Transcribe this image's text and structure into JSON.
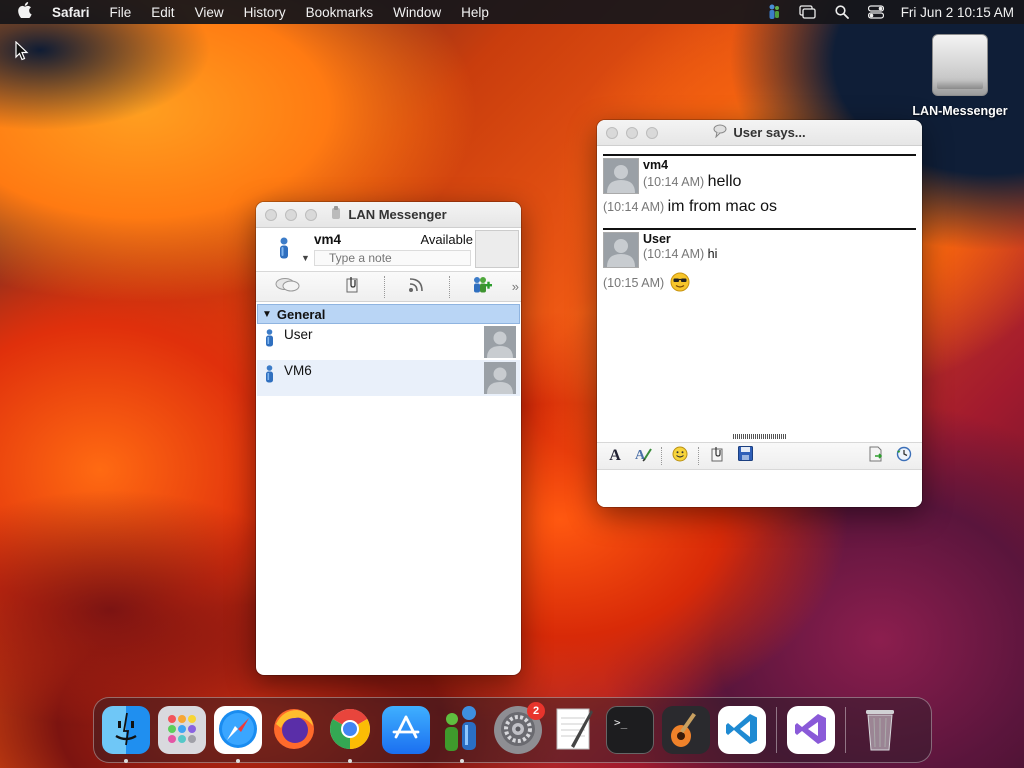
{
  "menubar": {
    "app_name": "Safari",
    "items": [
      "File",
      "Edit",
      "View",
      "History",
      "Bookmarks",
      "Window",
      "Help"
    ],
    "clock": "Fri Jun 2  10:15 AM"
  },
  "desktop": {
    "drive_label": "LAN-Messenger"
  },
  "lan_window": {
    "title": "LAN Messenger",
    "user_name": "vm4",
    "status": "Available",
    "note_placeholder": "Type a note",
    "group_name": "General",
    "contacts": [
      {
        "name": "User"
      },
      {
        "name": "VM6"
      }
    ]
  },
  "chat_window": {
    "title": "User says...",
    "messages": [
      {
        "sender": "vm4",
        "time": "(10:14 AM)",
        "text": "hello",
        "extra_time": "(10:14 AM)",
        "extra_text": "im from mac os"
      },
      {
        "sender": "User",
        "time": "(10:14 AM)",
        "text": "hi",
        "extra_time": "(10:15 AM)",
        "extra_emoji": "cool-sunglasses-emoji"
      }
    ]
  },
  "dock": {
    "apps": [
      "Finder",
      "Launchpad",
      "Safari",
      "Firefox",
      "Chrome",
      "App Store",
      "LAN Messenger",
      "System Preferences",
      "TextEdit",
      "Terminal",
      "GarageBand",
      "Visual Studio Code",
      "Visual Studio",
      "Trash"
    ],
    "system_prefs_badge": "2"
  },
  "colors": {
    "group_highlight": "#b9d5f5",
    "alt_row": "#e9f0fa",
    "badge_red": "#e8342c"
  }
}
